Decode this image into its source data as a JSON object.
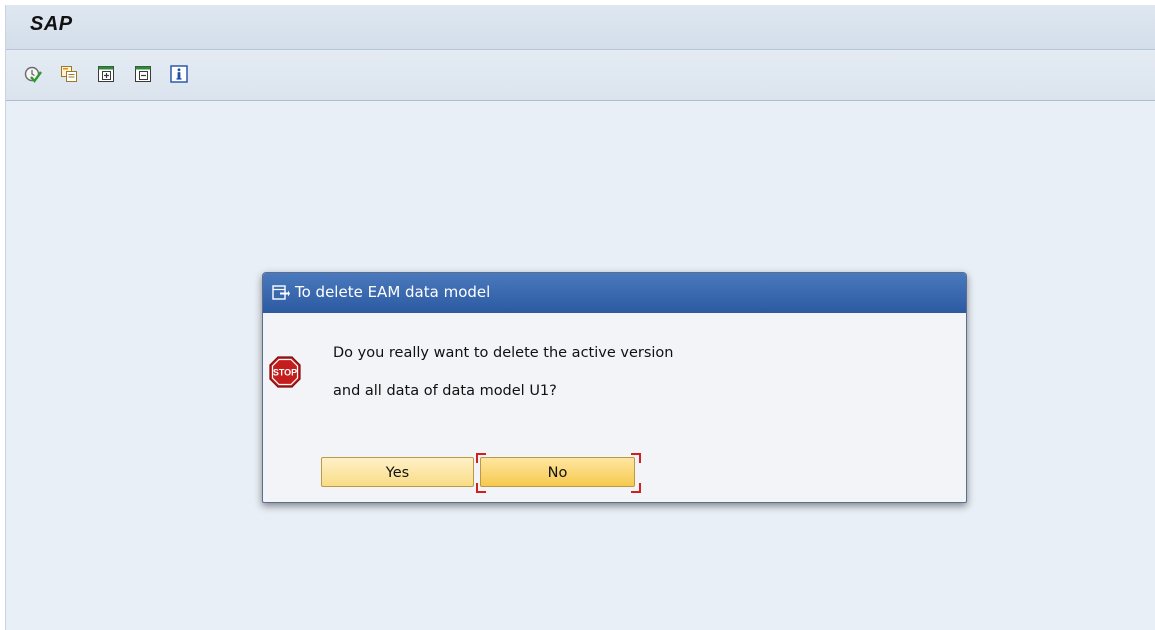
{
  "app": {
    "title": "SAP"
  },
  "toolbar": {
    "icons": [
      "execute-icon",
      "copy-icon",
      "expand-icon",
      "collapse-icon",
      "info-icon"
    ]
  },
  "dialog": {
    "title": "To delete EAM data model",
    "message_line1": "Do you really want to delete the active version",
    "message_line2": "and all data of data model U1?",
    "icon": "stop-icon",
    "yes_label": "Yes",
    "no_label": "No",
    "focused_button": "No"
  },
  "colors": {
    "dialog_header": "#2b5aa1",
    "button_fill": "#f9dc86",
    "focus_marker": "#d02020",
    "background": "#e9eff6"
  }
}
